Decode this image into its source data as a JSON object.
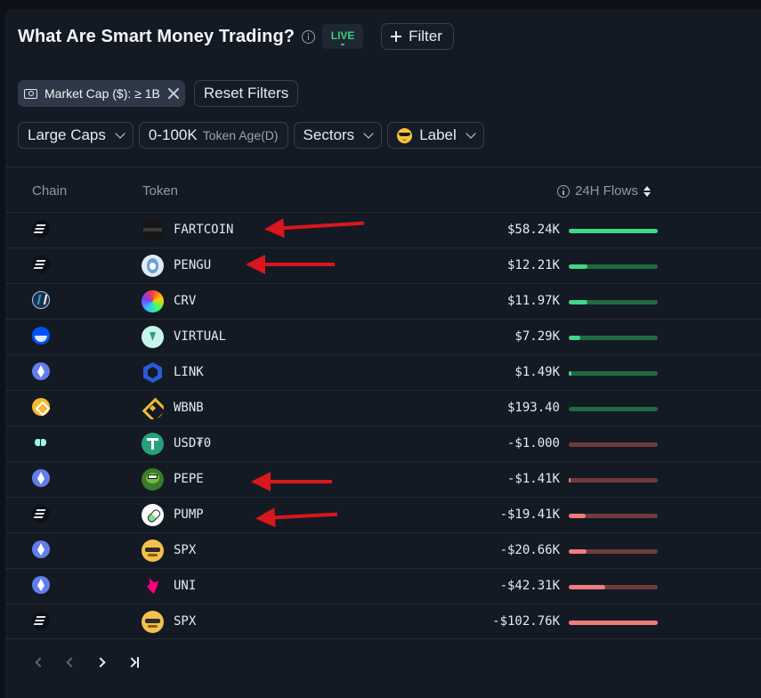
{
  "header": {
    "title": "What Are Smart Money Trading?",
    "live_label": "LIVE",
    "filter_label": "Filter"
  },
  "active_filters": {
    "market_cap_chip": "Market Cap ($): ≥ 1B",
    "reset_label": "Reset Filters"
  },
  "filters": {
    "size": "Large Caps",
    "token_age_value": "0-100K",
    "token_age_label": "Token Age(D)",
    "sectors": "Sectors",
    "label": "Label"
  },
  "table": {
    "columns": {
      "chain": "Chain",
      "token": "Token",
      "flows": "24H Flows"
    },
    "rows": [
      {
        "chain": "solana",
        "token": "FARTCOIN",
        "flow": "$58.24K",
        "sign": "pos",
        "fill": 1.0
      },
      {
        "chain": "solana",
        "token": "PENGU",
        "flow": "$12.21K",
        "sign": "pos",
        "fill": 0.21
      },
      {
        "chain": "arbitrum",
        "token": "CRV",
        "flow": "$11.97K",
        "sign": "pos",
        "fill": 0.21
      },
      {
        "chain": "base",
        "token": "VIRTUAL",
        "flow": "$7.29K",
        "sign": "pos",
        "fill": 0.13
      },
      {
        "chain": "ethereum",
        "token": "LINK",
        "flow": "$1.49K",
        "sign": "pos",
        "fill": 0.03
      },
      {
        "chain": "bnb",
        "token": "WBNB",
        "flow": "$193.40",
        "sign": "pos",
        "fill": 0.0
      },
      {
        "chain": "hyperliquid",
        "token": "USD₮0",
        "flow": "-$1.000",
        "sign": "neg",
        "fill": 0.0
      },
      {
        "chain": "ethereum",
        "token": "PEPE",
        "flow": "-$1.41K",
        "sign": "neg",
        "fill": 0.01
      },
      {
        "chain": "solana",
        "token": "PUMP",
        "flow": "-$19.41K",
        "sign": "neg",
        "fill": 0.19
      },
      {
        "chain": "ethereum",
        "token": "SPX",
        "flow": "-$20.66K",
        "sign": "neg",
        "fill": 0.2
      },
      {
        "chain": "ethereum",
        "token": "UNI",
        "flow": "-$42.31K",
        "sign": "neg",
        "fill": 0.41
      },
      {
        "chain": "solana",
        "token": "SPX",
        "flow": "-$102.76K",
        "sign": "neg",
        "fill": 1.0
      }
    ]
  },
  "colors": {
    "positive": "#41d684",
    "negative": "#f07c7c",
    "arrow": "#d9171c",
    "live": "#37d07a"
  }
}
